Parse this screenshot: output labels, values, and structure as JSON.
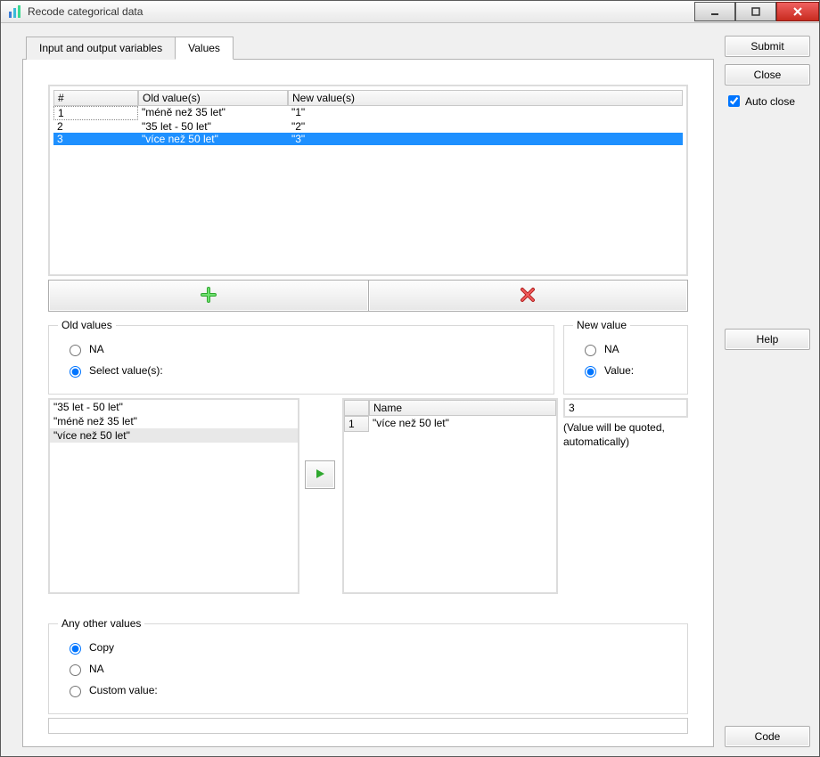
{
  "window": {
    "title": "Recode categorical data"
  },
  "side": {
    "submit": "Submit",
    "close": "Close",
    "auto_close": "Auto close",
    "help": "Help",
    "code": "Code"
  },
  "tabs": {
    "io": "Input and output variables",
    "values": "Values",
    "active": "values"
  },
  "table": {
    "headers": {
      "num": "#",
      "old": "Old value(s)",
      "new": "New value(s)"
    },
    "rows": [
      {
        "num": "1",
        "old": "\"méně než 35 let\"",
        "new": "\"1\""
      },
      {
        "num": "2",
        "old": "\"35 let - 50 let\"",
        "new": "\"2\""
      },
      {
        "num": "3",
        "old": "\"více než 50 let\"",
        "new": "\"3\"",
        "selected": true
      }
    ]
  },
  "old_values": {
    "legend": "Old values",
    "na_label": "NA",
    "select_label": "Select value(s):",
    "selected_radio": "select",
    "available": [
      {
        "label": "\"35 let - 50 let\""
      },
      {
        "label": "\"méně než 35 let\""
      },
      {
        "label": "\"více než 50 let\"",
        "sel": true
      }
    ],
    "selected_header": {
      "num": "",
      "name": "Name"
    },
    "selected_rows": [
      {
        "num": "1",
        "name": "\"více než 50 let\""
      }
    ]
  },
  "new_value": {
    "legend": "New value",
    "na_label": "NA",
    "value_label": "Value:",
    "selected_radio": "value",
    "value": "3",
    "hint": "(Value will be quoted, automatically)"
  },
  "other": {
    "legend": "Any other values",
    "copy": "Copy",
    "na": "NA",
    "custom": "Custom value:",
    "selected": "copy"
  }
}
